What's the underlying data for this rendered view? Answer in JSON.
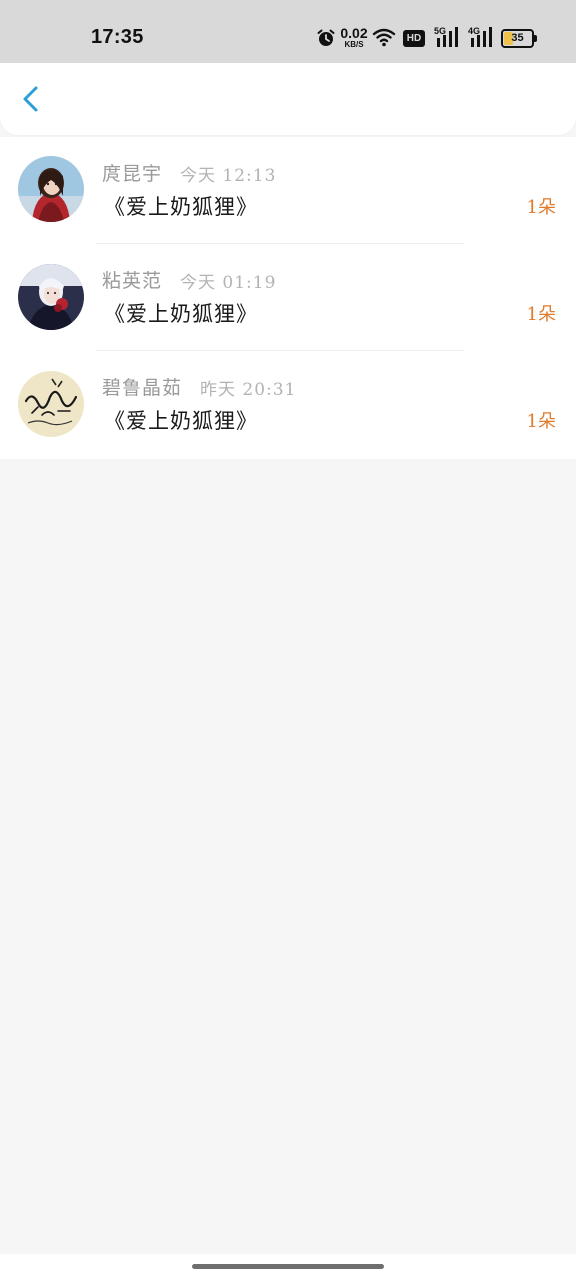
{
  "status_bar": {
    "time": "17:35",
    "net_speed_value": "0.02",
    "net_speed_unit": "KB/S",
    "hd_label": "HD",
    "sim1_label": "5G",
    "sim2_label": "4G",
    "battery_level": "35",
    "battery_fraction": 0.35,
    "icons": [
      "alarm-icon",
      "wifi-icon",
      "hd-icon",
      "signal-5g-icon",
      "signal-4g-icon",
      "battery-icon"
    ]
  },
  "header": {
    "back_icon": "chevron-left-icon",
    "accent_color": "#2a9fd8"
  },
  "records": [
    {
      "sender": "庹昆宇",
      "time": "今天 12:13",
      "gift": "《爱上奶狐狸》",
      "count": "1朵",
      "avatar": "avatar-1"
    },
    {
      "sender": "粘英范",
      "time": "今天 01:19",
      "gift": "《爱上奶狐狸》",
      "count": "1朵",
      "avatar": "avatar-2"
    },
    {
      "sender": "碧鲁晶茹",
      "time": "昨天 20:31",
      "gift": "《爱上奶狐狸》",
      "count": "1朵",
      "avatar": "avatar-3"
    }
  ],
  "colors": {
    "count": "#e07b2c",
    "sender": "#9a9a9a",
    "time": "#b3b3b3",
    "gift": "#1a1a1a",
    "background": "#f7f6f7"
  }
}
